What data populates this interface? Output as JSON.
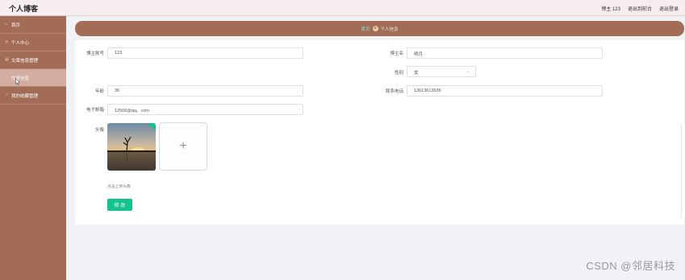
{
  "header": {
    "app_title": "个人博客",
    "user_label": "博主 123",
    "back_to_front": "退出到前台",
    "logout": "退出登录"
  },
  "sidebar": {
    "items": [
      {
        "label": "首页",
        "icon": "home-icon"
      },
      {
        "label": "个人中心",
        "icon": "user-icon"
      },
      {
        "label": "文章信息管理",
        "icon": "document-icon"
      },
      {
        "label": "文章信息",
        "icon": ""
      },
      {
        "label": "我的收藏管理",
        "icon": "star-icon"
      }
    ]
  },
  "breadcrumb": {
    "home": "首页",
    "separator_icon": "star-badge-icon",
    "current": "个人信息"
  },
  "form": {
    "account_label": "博主账号",
    "account_value": "123",
    "name_label": "博主名",
    "name_value": "明月",
    "gender_label": "性别",
    "gender_value": "女",
    "age_label": "年龄",
    "age_value": "36",
    "phone_label": "联系电话",
    "phone_value": "13613613636",
    "email_label": "电子邮箱",
    "email_value": "12566@qq。com",
    "avatar_label": "头像",
    "upload_hint": "点击上传头像",
    "submit_label": "修 改"
  },
  "watermark": "CSDN @邻居科技",
  "colors": {
    "sidebar_bg": "#a26c57",
    "accent": "#13c38b",
    "topbar_bg": "#f6eeee"
  }
}
